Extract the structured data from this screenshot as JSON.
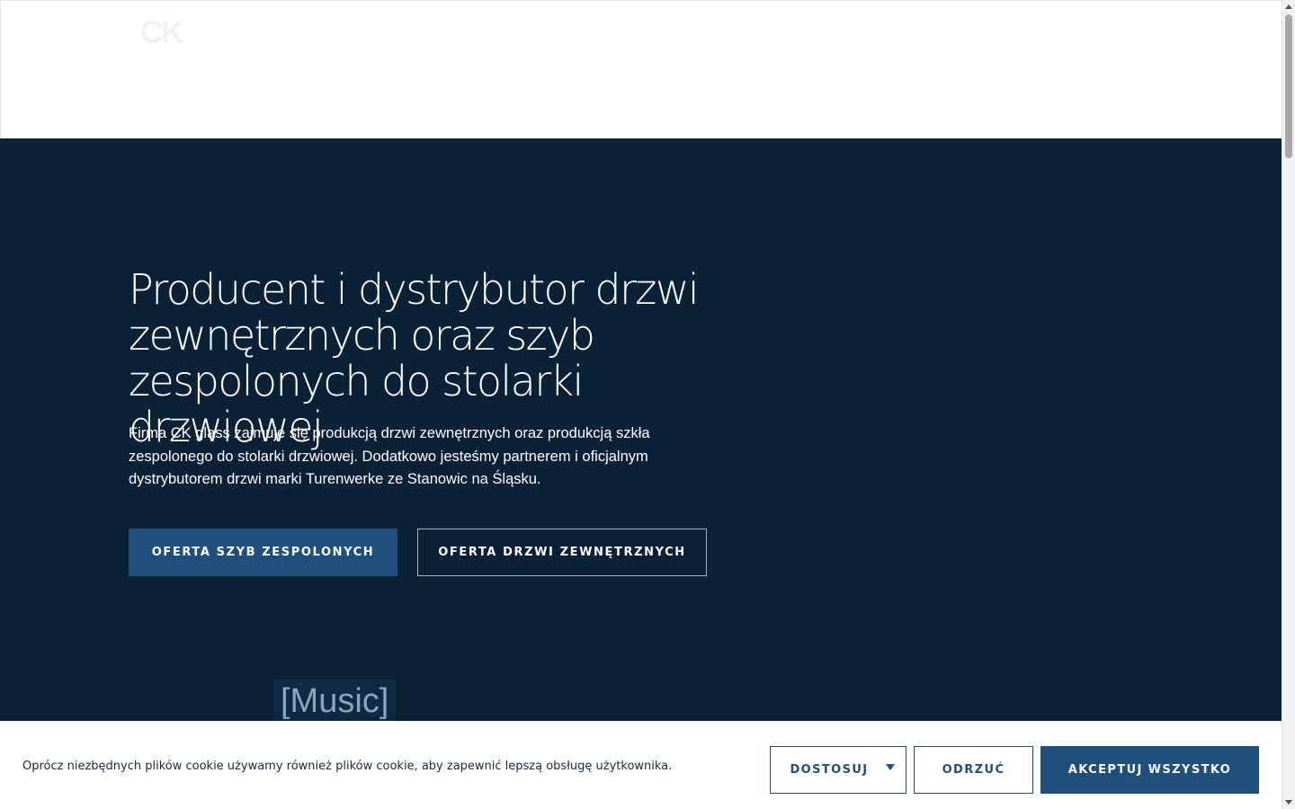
{
  "header": {
    "logo_text": "CK"
  },
  "hero": {
    "title": "Producent i dystrybutor drzwi zewnętrznych oraz szyb zespolonych do stolarki drzwiowej",
    "description": "Firma CK glass zajmuje się produkcją drzwi zewnętrznych oraz produkcją szkła zespolonego do stolarki drzwiowej. Dodatkowo jesteśmy partnerem i oficjalnym dystrybutorem drzwi marki Turenwerke ze Stanowic na Śląsku.",
    "primary_button": "OFERTA SZYB ZESPOLONYCH",
    "secondary_button": "OFERTA DRZWI ZEWNĘTRZNYCH",
    "video_caption": "[Music]"
  },
  "cookie_banner": {
    "text": "Oprócz niezbędnych plików cookie używamy również plików cookie, aby zapewnić lepszą obsługę użytkownika.",
    "customize_label": "DOSTOSUJ",
    "reject_label": "ODRZUĆ",
    "accept_label": "AKCEPTUJ WSZYSTKO"
  },
  "colors": {
    "hero_background": "#0b2136",
    "accent": "#1f4f7c",
    "text_light": "#ffffff",
    "text_dark": "#1b2b3d"
  },
  "icons": {
    "customize_dropdown": "caret-down-icon"
  }
}
